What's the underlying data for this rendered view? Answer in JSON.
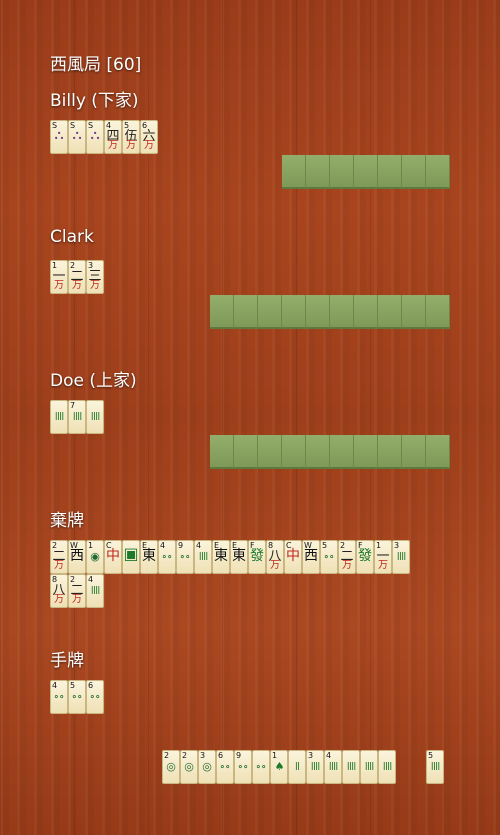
{
  "round": {
    "title": "西風局 [60]"
  },
  "players": [
    {
      "label": "Billy (下家)",
      "hidden_count": 7
    },
    {
      "label": "Clark",
      "hidden_count": 10
    },
    {
      "label": "Doe (上家)",
      "hidden_count": 10
    }
  ],
  "melds": {
    "billy": [
      {
        "n": "S",
        "g": "⛬",
        "s": "",
        "cls": "f"
      },
      {
        "n": "S",
        "g": "⛬",
        "s": "",
        "cls": "f"
      },
      {
        "n": "S",
        "g": "⛬",
        "s": "",
        "cls": "f"
      },
      {
        "n": "4",
        "g": "四",
        "s": "万",
        "cls": "m"
      },
      {
        "n": "5",
        "g": "伍",
        "s": "万",
        "cls": "m"
      },
      {
        "n": "6",
        "g": "六",
        "s": "万",
        "cls": "m"
      }
    ],
    "clark": [
      {
        "n": "1",
        "g": "一",
        "s": "万",
        "cls": "m"
      },
      {
        "n": "2",
        "g": "二",
        "s": "万",
        "cls": "m"
      },
      {
        "n": "3",
        "g": "三",
        "s": "万",
        "cls": "m"
      }
    ],
    "doe": [
      {
        "n": "",
        "g": "ǁǁ",
        "s": "",
        "cls": "b"
      },
      {
        "n": "7",
        "g": "ǁǁ",
        "s": "",
        "cls": "b"
      },
      {
        "n": "",
        "g": "ǁǁ",
        "s": "",
        "cls": "b"
      }
    ]
  },
  "discards_label": "棄牌",
  "discards": [
    {
      "n": "2",
      "g": "二",
      "s": "万",
      "cls": "m"
    },
    {
      "n": "W",
      "g": "西",
      "s": "",
      "cls": "w"
    },
    {
      "n": "1",
      "g": "◉",
      "s": "",
      "cls": "p"
    },
    {
      "n": "C",
      "g": "中",
      "s": "",
      "cls": "dr"
    },
    {
      "n": "",
      "g": "▣",
      "s": "",
      "cls": "dw"
    },
    {
      "n": "E",
      "g": "東",
      "s": "",
      "cls": "w"
    },
    {
      "n": "4",
      "g": "∘∘",
      "s": "",
      "cls": "p"
    },
    {
      "n": "9",
      "g": "∘∘",
      "s": "",
      "cls": "p"
    },
    {
      "n": "4",
      "g": "ǁǁ",
      "s": "",
      "cls": "b"
    },
    {
      "n": "E",
      "g": "東",
      "s": "",
      "cls": "w"
    },
    {
      "n": "E",
      "g": "東",
      "s": "",
      "cls": "w"
    },
    {
      "n": "F",
      "g": "發",
      "s": "",
      "cls": "dg"
    },
    {
      "n": "8",
      "g": "八",
      "s": "万",
      "cls": "m"
    },
    {
      "n": "C",
      "g": "中",
      "s": "",
      "cls": "dr"
    },
    {
      "n": "W",
      "g": "西",
      "s": "",
      "cls": "w"
    },
    {
      "n": "5",
      "g": "∘∘",
      "s": "",
      "cls": "p"
    },
    {
      "n": "2",
      "g": "二",
      "s": "万",
      "cls": "m"
    },
    {
      "n": "F",
      "g": "發",
      "s": "",
      "cls": "dg"
    },
    {
      "n": "1",
      "g": "一",
      "s": "万",
      "cls": "m"
    },
    {
      "n": "3",
      "g": "ǁǁ",
      "s": "",
      "cls": "b"
    },
    {
      "n": "8",
      "g": "八",
      "s": "万",
      "cls": "m"
    },
    {
      "n": "2",
      "g": "二",
      "s": "万",
      "cls": "m"
    },
    {
      "n": "4",
      "g": "ǁǁ",
      "s": "",
      "cls": "b"
    }
  ],
  "hand_label": "手牌",
  "exposed": [
    {
      "n": "4",
      "g": "∘∘",
      "s": "",
      "cls": "p"
    },
    {
      "n": "5",
      "g": "∘∘",
      "s": "",
      "cls": "p"
    },
    {
      "n": "6",
      "g": "∘∘",
      "s": "",
      "cls": "p"
    }
  ],
  "hand": [
    {
      "n": "2",
      "g": "◎",
      "s": "",
      "cls": "p"
    },
    {
      "n": "2",
      "g": "◎",
      "s": "",
      "cls": "p"
    },
    {
      "n": "3",
      "g": "◎",
      "s": "",
      "cls": "p"
    },
    {
      "n": "6",
      "g": "∘∘",
      "s": "",
      "cls": "p"
    },
    {
      "n": "9",
      "g": "∘∘",
      "s": "",
      "cls": "p"
    },
    {
      "n": "",
      "g": "∘∘",
      "s": "",
      "cls": "p"
    },
    {
      "n": "1",
      "g": "♠",
      "s": "",
      "cls": "b"
    },
    {
      "n": "",
      "g": "ǁ",
      "s": "",
      "cls": "b"
    },
    {
      "n": "3",
      "g": "ǁǁ",
      "s": "",
      "cls": "b"
    },
    {
      "n": "4",
      "g": "ǁǁ",
      "s": "",
      "cls": "b"
    },
    {
      "n": "",
      "g": "ǁǁ",
      "s": "",
      "cls": "b"
    },
    {
      "n": "",
      "g": "ǁǁ",
      "s": "",
      "cls": "b"
    },
    {
      "n": "",
      "g": "ǁǁ",
      "s": "",
      "cls": "b"
    }
  ],
  "drawn": [
    {
      "n": "5",
      "g": "ǁǁ",
      "s": "",
      "cls": "b"
    }
  ]
}
